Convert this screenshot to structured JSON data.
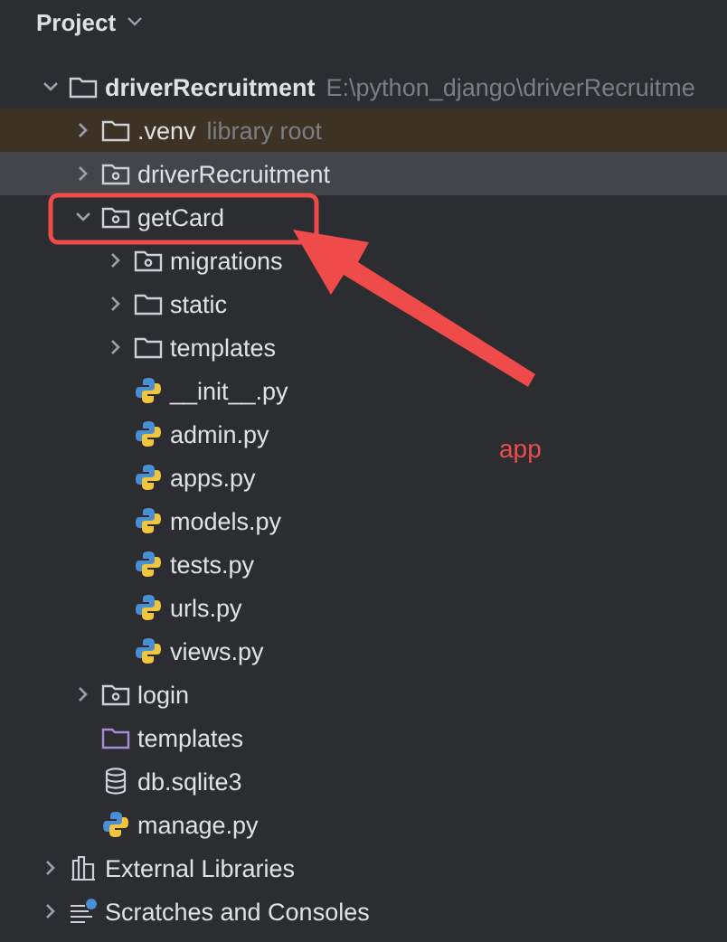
{
  "panel": {
    "title": "Project"
  },
  "tree": [
    {
      "kind": "folder",
      "name": "driverRecruitment",
      "path": "E:\\python_django\\driverRecruitme",
      "expanded": true,
      "selected": false,
      "tinted": false,
      "children": [
        {
          "kind": "folder",
          "name": ".venv",
          "hint": "library root",
          "expanded": false,
          "selected": false,
          "tinted": true
        },
        {
          "kind": "module",
          "name": "driverRecruitment",
          "expanded": false,
          "selected": true,
          "tinted": false
        },
        {
          "kind": "module",
          "name": "getCard",
          "expanded": true,
          "selected": false,
          "tinted": false,
          "children": [
            {
              "kind": "module",
              "name": "migrations",
              "expanded": false,
              "selected": false,
              "tinted": false
            },
            {
              "kind": "folder",
              "name": "static",
              "expanded": false,
              "selected": false,
              "tinted": false
            },
            {
              "kind": "folder",
              "name": "templates",
              "expanded": false,
              "selected": false,
              "tinted": false
            },
            {
              "kind": "python",
              "name": "__init__.py",
              "selected": false,
              "tinted": false
            },
            {
              "kind": "python",
              "name": "admin.py",
              "selected": false,
              "tinted": false
            },
            {
              "kind": "python",
              "name": "apps.py",
              "selected": false,
              "tinted": false
            },
            {
              "kind": "python",
              "name": "models.py",
              "selected": false,
              "tinted": false
            },
            {
              "kind": "python",
              "name": "tests.py",
              "selected": false,
              "tinted": false
            },
            {
              "kind": "python",
              "name": "urls.py",
              "selected": false,
              "tinted": false
            },
            {
              "kind": "python",
              "name": "views.py",
              "selected": false,
              "tinted": false
            }
          ]
        },
        {
          "kind": "module",
          "name": "login",
          "expanded": false,
          "selected": false,
          "tinted": false
        },
        {
          "kind": "templates",
          "name": "templates",
          "selected": false,
          "tinted": false
        },
        {
          "kind": "database",
          "name": "db.sqlite3",
          "selected": false,
          "tinted": false
        },
        {
          "kind": "python",
          "name": "manage.py",
          "selected": false,
          "tinted": false
        }
      ]
    },
    {
      "kind": "libraries",
      "name": "External Libraries",
      "expanded": false,
      "selected": false,
      "tinted": false
    },
    {
      "kind": "scratches",
      "name": "Scratches and Consoles",
      "expanded": false,
      "selected": false,
      "tinted": false
    }
  ],
  "annotation": {
    "label": "app"
  }
}
